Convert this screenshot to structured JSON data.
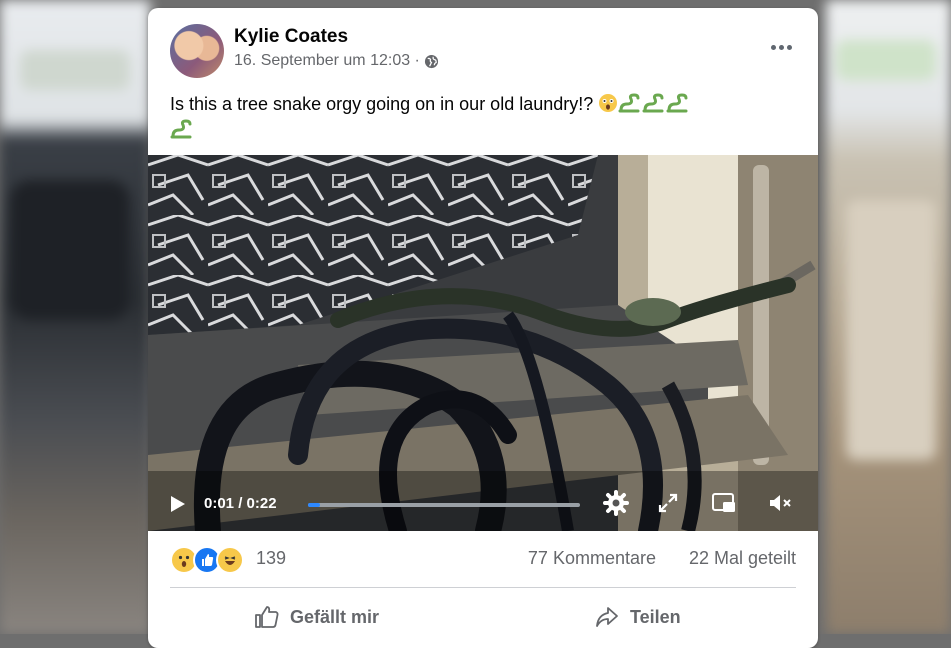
{
  "post": {
    "author": "Kylie Coates",
    "timestamp": "16. September um 12:03 ·",
    "audience_icon": "globe-icon",
    "text": "Is this a tree snake orgy going on in our old laundry!?",
    "text_emojis": [
      "astonished-face",
      "snake",
      "snake",
      "snake",
      "snake"
    ]
  },
  "video": {
    "current_time": "0:01",
    "duration": "0:22",
    "time_display": "0:01 / 0:22",
    "progress_fraction": 0.045
  },
  "reactions": {
    "types": [
      "wow",
      "like",
      "haha"
    ],
    "count": "139",
    "comments": "77 Kommentare",
    "shares": "22 Mal geteilt"
  },
  "actions": {
    "like_label": "Gefällt mir",
    "share_label": "Teilen"
  },
  "colors": {
    "accent": "#2d88ff",
    "like_blue": "#1877f2",
    "wow_yellow": "#f7c84a",
    "secondary_text": "#65676b"
  }
}
